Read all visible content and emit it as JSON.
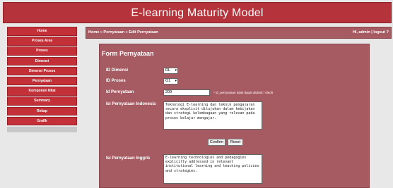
{
  "app": {
    "title": "E-learning Maturity Model"
  },
  "sidebar": {
    "items": [
      {
        "label": "Home"
      },
      {
        "label": "Proses Area"
      },
      {
        "label": "Proses"
      },
      {
        "label": "Dimensi"
      },
      {
        "label": "Dimensi Proses"
      },
      {
        "label": "Pernyataan"
      },
      {
        "label": "Komponen Nilai"
      },
      {
        "label": "Summary"
      },
      {
        "label": "Rekap"
      },
      {
        "label": "Grafik"
      }
    ]
  },
  "breadcrumb": {
    "items": [
      "Home",
      "Pernyataan",
      "Edit Pernyataan"
    ],
    "sep": "»"
  },
  "user": {
    "greeting": "Hi, admin",
    "sep": "|",
    "logout": "logout ?"
  },
  "form": {
    "title": "Form Pernyataan",
    "fields": {
      "id_dimensi": {
        "label": "ID Dimensi",
        "value": "DL"
      },
      "id_proses": {
        "label": "ID Proses",
        "value": "O1"
      },
      "id_pernyataan": {
        "label": "Id Pernyataan",
        "value": "209",
        "note": "* id_pernyataan tidak dapat diubah / diedit"
      },
      "isi_indonesia": {
        "label": "Isi Pernyataan Indonesia",
        "value": "Teknologi E-learning dan teknik pengajaran secara eksplisit ditujukan dalam kebijakan dan strategi kelembagaan yang relevan pada proses belajar mengajar."
      },
      "isi_inggris": {
        "label": "Isi Pernyataan Inggris",
        "value": "E-learning technologies and pedagogies explicitly addressed in relevant institutional learning and teaching policies and strategies."
      }
    },
    "buttons": {
      "confirm": "Confirm",
      "reset": "Reset"
    }
  },
  "colors": {
    "header": "#b5333a",
    "nav": "#c33038",
    "panel": "#a65a61",
    "background": "#e8e8e8"
  }
}
